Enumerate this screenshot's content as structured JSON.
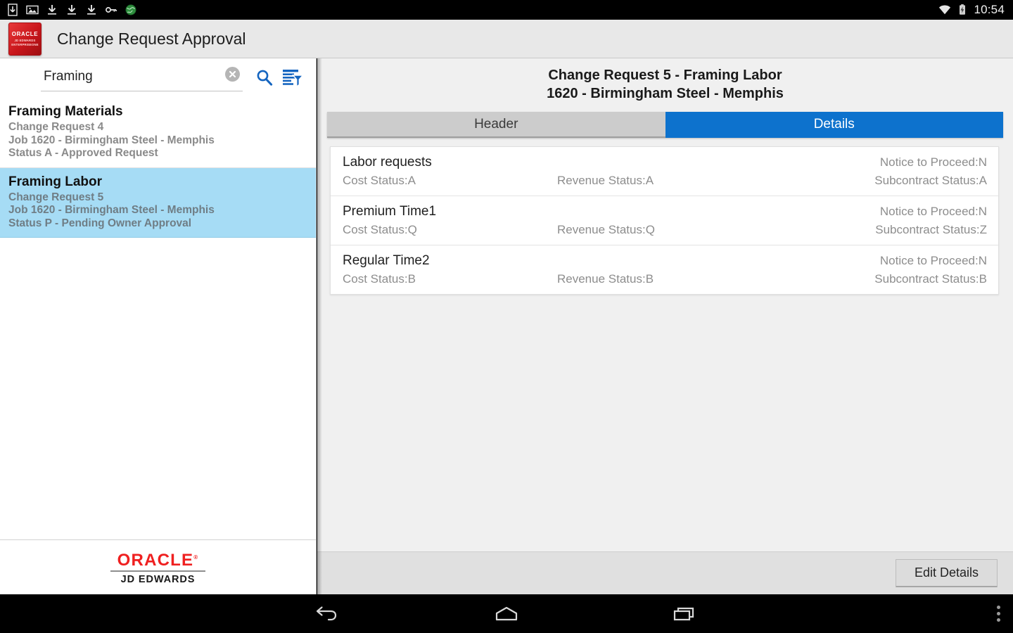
{
  "statusbar": {
    "time": "10:54",
    "left_icons": [
      {
        "name": "save-to-device-icon"
      },
      {
        "name": "image-icon"
      },
      {
        "name": "download-icon"
      },
      {
        "name": "download-icon"
      },
      {
        "name": "download-icon"
      },
      {
        "name": "vpn-key-icon"
      },
      {
        "name": "globe-icon"
      }
    ],
    "right_icons": [
      {
        "name": "wifi-icon"
      },
      {
        "name": "battery-charging-icon"
      }
    ]
  },
  "appbar": {
    "title": "Change Request Approval",
    "logo": {
      "line1": "ORACLE",
      "line2": "JD EDWARDS",
      "line3": "ENTERPRISEONE"
    }
  },
  "search": {
    "value": "Framing",
    "placeholder": "Search",
    "clear_icon": "close-circle-icon",
    "search_icon": "search-icon",
    "filter_icon": "filter-list-icon"
  },
  "results": [
    {
      "title": "Framing Materials",
      "request": "Change Request 4",
      "job": "Job 1620 - Birmingham Steel - Memphis",
      "status": "Status A - Approved Request",
      "selected": false
    },
    {
      "title": "Framing Labor",
      "request": "Change Request 5",
      "job": "Job 1620 - Birmingham Steel - Memphis",
      "status": "Status P - Pending Owner Approval",
      "selected": true
    }
  ],
  "footer_logo": {
    "oracle": "ORACLE",
    "trademark": "®",
    "jde": "JD EDWARDS"
  },
  "detail": {
    "title_line1": "Change Request 5 - Framing Labor",
    "title_line2": "1620 - Birmingham Steel - Memphis",
    "tabs": [
      {
        "label": "Header",
        "active": false
      },
      {
        "label": "Details",
        "active": true
      }
    ],
    "rows": [
      {
        "name": "Labor requests",
        "notice": "Notice to Proceed:N",
        "cost": "Cost Status:A",
        "revenue": "Revenue Status:A",
        "subcontract": "Subcontract Status:A"
      },
      {
        "name": "Premium Time1",
        "notice": "Notice to Proceed:N",
        "cost": "Cost Status:Q",
        "revenue": "Revenue Status:Q",
        "subcontract": "Subcontract Status:Z"
      },
      {
        "name": "Regular Time2",
        "notice": "Notice to Proceed:N",
        "cost": "Cost Status:B",
        "revenue": "Revenue Status:B",
        "subcontract": "Subcontract Status:B"
      }
    ],
    "edit_button": "Edit Details"
  },
  "navbar": {
    "back": "back-icon",
    "home": "home-icon",
    "recents": "recents-icon",
    "overflow": "overflow-menu-icon"
  },
  "colors": {
    "accent_blue": "#0d72cd",
    "selection_blue": "#a6dcf5",
    "oracle_red": "#ef2020",
    "tab_inactive": "#cccccc"
  }
}
